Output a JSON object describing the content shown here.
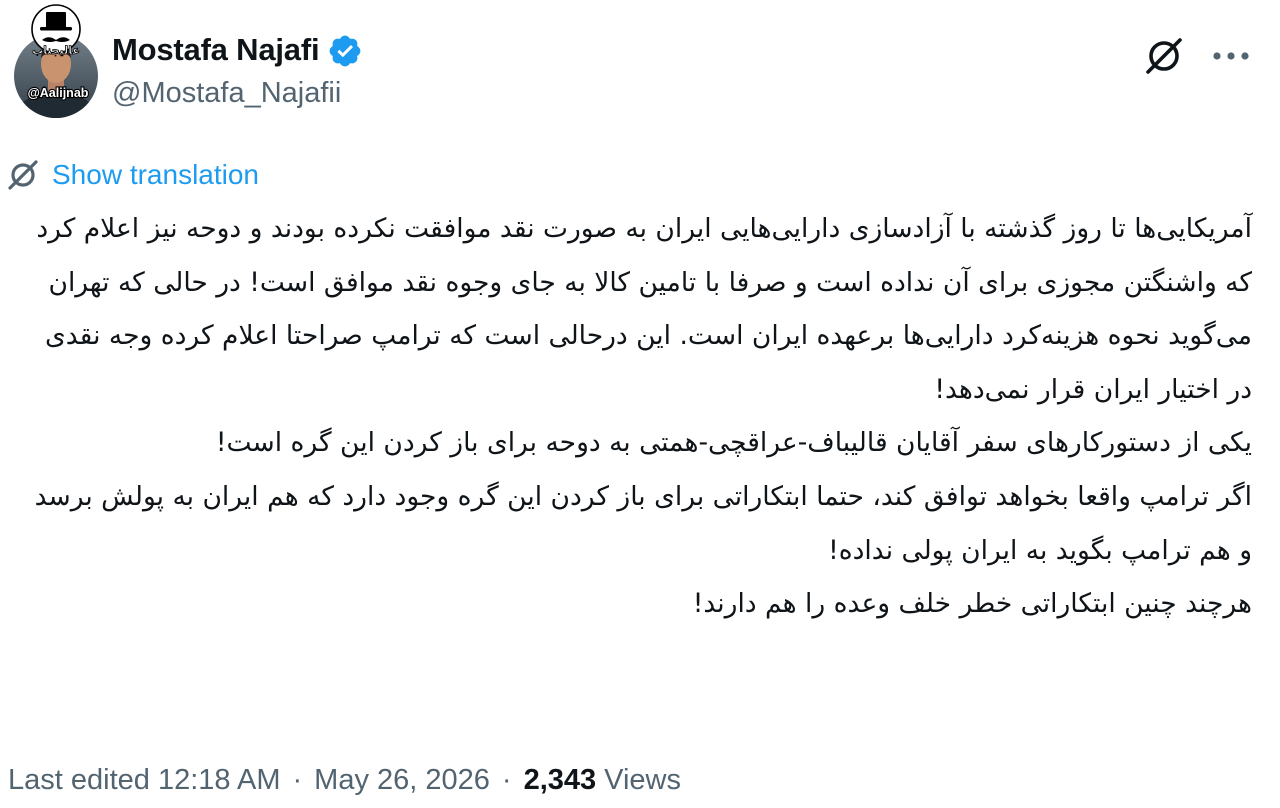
{
  "author": {
    "display_name": "Mostafa Najafi",
    "handle": "@Mostafa_Najafii",
    "verified": true,
    "avatar_watermark": "@Aalijnab",
    "avatar_overlay_text": "عالیجناب"
  },
  "translation": {
    "label": "Show translation"
  },
  "tweet": {
    "paragraphs": [
      "آمریکایی‌ها تا روز گذشته با آزادسازی دارایی‌هایی ایران به صورت نقد موافقت نکرده بودند و دوحه نیز اعلام کرد که واشنگتن مجوزی برای آن نداده است و صرفا با تامین کالا به جای وجوه نقد موافق است! در حالی که تهران می‌گوید نحوه هزینه‌کرد دارایی‌ها برعهده ایران است. این درحالی است که ترامپ صراحتا اعلام کرده وجه نقدی در اختیار ایران قرار نمی‌دهد!",
      "یکی از دستورکارهای سفر آقایان قالیباف-عراقچی-همتی به دوحه برای باز کردن این گره است!",
      "اگر ترامپ واقعا بخواهد توافق کند، حتما ابتکاراتی برای باز کردن این گره وجود دارد که هم ایران به پولش برسد و هم ترامپ بگوید به ایران پولی نداده!",
      "هرچند چنین ابتکاراتی خطر خلف وعده را هم دارند!"
    ]
  },
  "meta": {
    "edited_label": "Last edited 12:18 AM",
    "separator": "·",
    "date": "May 26, 2026",
    "views_count": "2,343",
    "views_label": "Views"
  },
  "colors": {
    "text_primary": "#0f1419",
    "text_secondary": "#536471",
    "accent": "#1d9bf0"
  },
  "icons": {
    "verified": "verified-badge-icon",
    "grok": "grok-icon",
    "more": "more-options-icon",
    "translate": "translate-icon"
  }
}
